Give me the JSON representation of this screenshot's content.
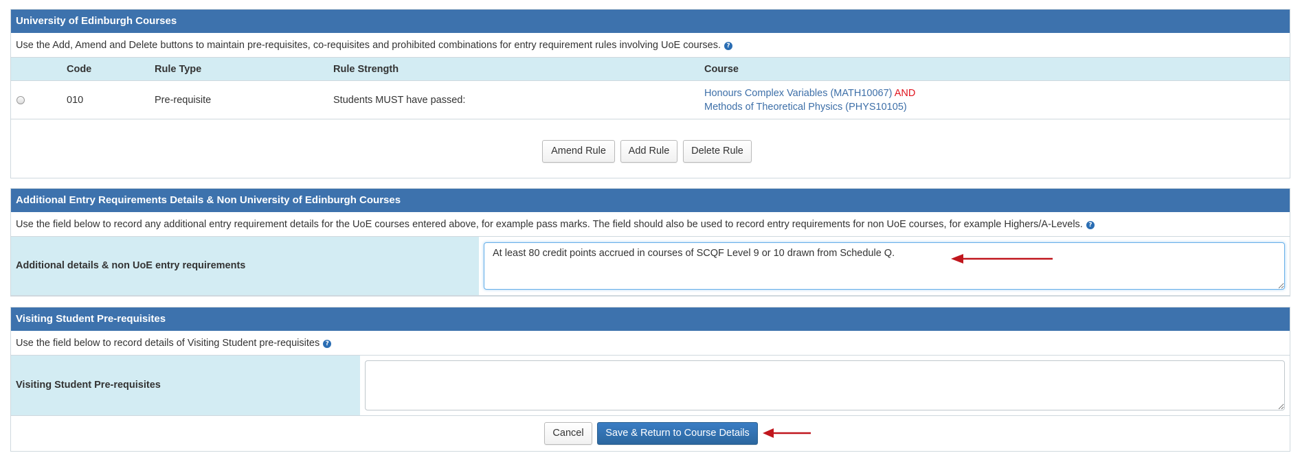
{
  "uoe": {
    "title": "University of Edinburgh Courses",
    "intro": "Use the Add, Amend and Delete buttons to maintain pre-requisites, co-requisites and prohibited combinations for entry requirement rules involving UoE courses.",
    "columns": {
      "code": "Code",
      "rule_type": "Rule Type",
      "rule_strength": "Rule Strength",
      "course": "Course"
    },
    "rows": [
      {
        "code": "010",
        "rule_type": "Pre-requisite",
        "rule_strength": "Students MUST have passed:",
        "course_1": "Honours Complex Variables (MATH10067)",
        "connector": "AND",
        "course_2": "Methods of Theoretical Physics (PHYS10105)"
      }
    ],
    "buttons": {
      "amend": "Amend Rule",
      "add": "Add Rule",
      "delete": "Delete Rule"
    }
  },
  "additional": {
    "title": "Additional Entry Requirements Details & Non University of Edinburgh Courses",
    "intro": "Use the field below to record any additional entry requirement details for the UoE courses entered above, for example pass marks. The field should also be used to record entry requirements for non UoE courses, for example Highers/A-Levels.",
    "field_label": "Additional details & non UoE entry requirements",
    "field_value": "At least 80 credit points accrued in courses of SCQF Level 9 or 10 drawn from Schedule Q."
  },
  "visiting": {
    "title": "Visiting Student Pre-requisites",
    "intro": "Use the field below to record details of Visiting Student pre-requisites",
    "field_label": "Visiting Student Pre-requisites",
    "field_value": ""
  },
  "actions": {
    "cancel": "Cancel",
    "save": "Save & Return to Course Details"
  },
  "help_icon_glyph": "?",
  "colors": {
    "header": "#3d72ad",
    "label_bg": "#d3ecf3",
    "link": "#3d6fa8",
    "and": "#e0141e",
    "arrow": "#c0161d",
    "primary": "#2f6ea9"
  }
}
